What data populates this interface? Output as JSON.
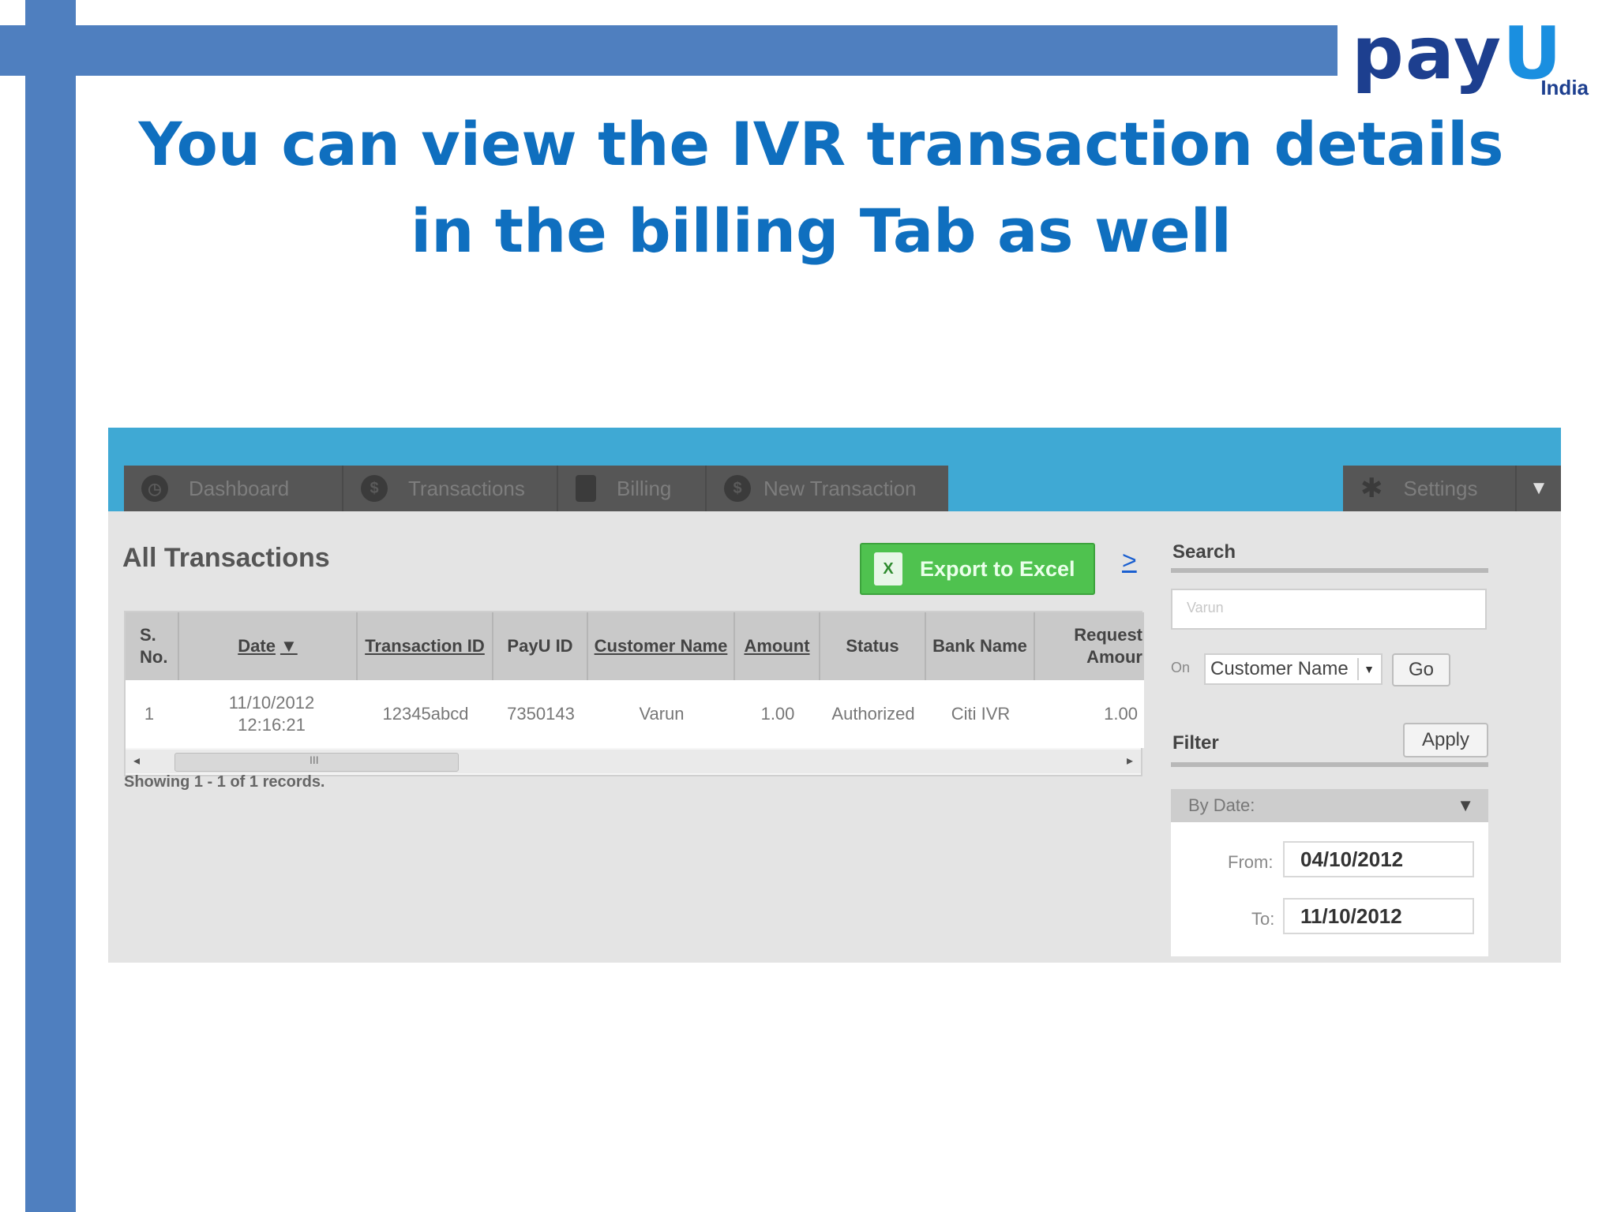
{
  "colors": {
    "accent_bar": "#4f7fbf",
    "title": "#0f6fbf",
    "app_topbar": "#3fa9d4",
    "export_button": "#4fc24f"
  },
  "logo": {
    "word_pay": "pay",
    "word_u": "U",
    "sub": "India"
  },
  "slide": {
    "title": "You can view the IVR transaction details in the billing Tab as well"
  },
  "nav": {
    "tabs": [
      {
        "label": "Dashboard",
        "icon": "clock-icon"
      },
      {
        "label": "Transactions",
        "icon": "dollar-icon"
      },
      {
        "label": "Billing",
        "icon": "document-icon"
      },
      {
        "label": "New Transaction",
        "icon": "new-transaction-icon"
      }
    ],
    "settings_label": "Settings"
  },
  "page": {
    "heading": "All Transactions",
    "export_label": "Export to Excel",
    "more_link": ">",
    "showing": "Showing 1 - 1 of 1 records."
  },
  "table": {
    "columns": [
      "S. No.",
      "Date",
      "Transaction ID",
      "PayU ID",
      "Customer Name",
      "Amount",
      "Status",
      "Bank Name",
      "Request Amour"
    ],
    "sort_indicator": "▼",
    "rows": [
      {
        "sno": "1",
        "date": "11/10/2012 12:16:21",
        "transaction_id": "12345abcd",
        "payu_id": "7350143",
        "customer_name": "Varun",
        "amount": "1.00",
        "status": "Authorized",
        "bank_name": "Citi IVR",
        "request_amount": "1.00"
      }
    ],
    "scroll_grip": "III"
  },
  "search": {
    "label": "Search",
    "value": "Varun",
    "on_label": "On",
    "field_selected": "Customer Name",
    "go_label": "Go"
  },
  "filter": {
    "label": "Filter",
    "apply_label": "Apply",
    "by_date_label": "By Date:",
    "from_label": "From:",
    "from_value": "04/10/2012",
    "to_label": "To:",
    "to_value": "11/10/2012"
  }
}
